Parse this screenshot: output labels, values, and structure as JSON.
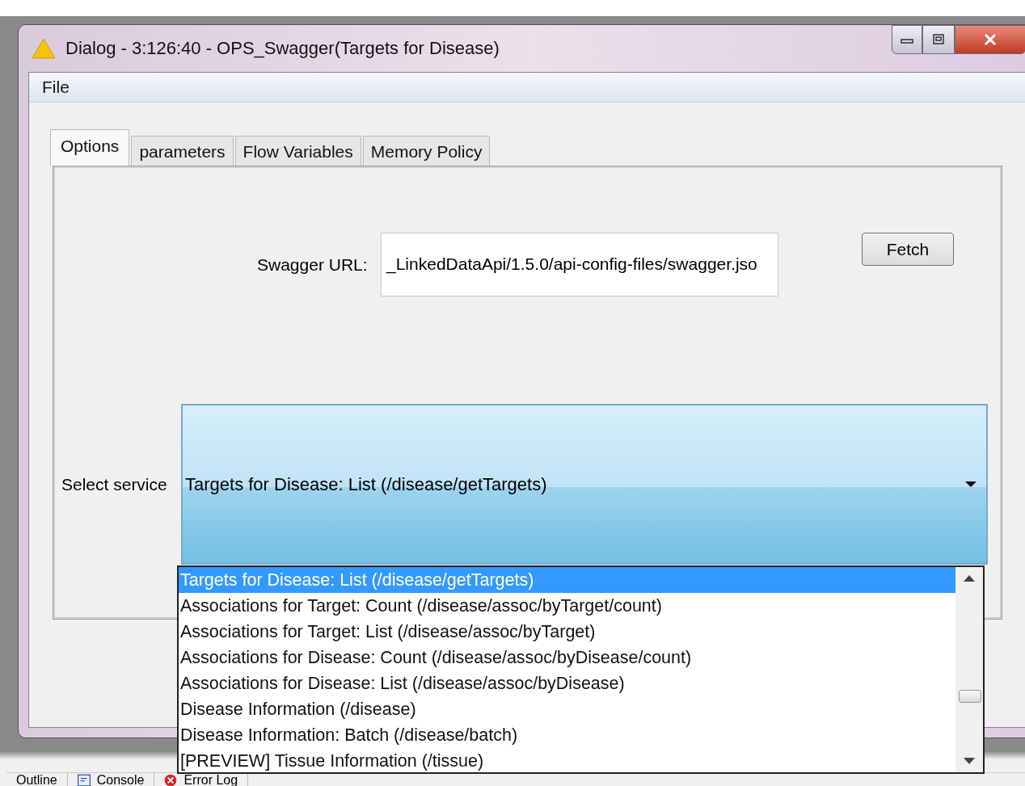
{
  "window": {
    "title": "Dialog - 3:126:40 - OPS_Swagger(Targets for Disease)"
  },
  "menu": [
    "File"
  ],
  "tabs": [
    {
      "label": "Options",
      "selected": true
    },
    {
      "label": "parameters",
      "selected": false
    },
    {
      "label": "Flow Variables",
      "selected": false
    },
    {
      "label": "Memory Policy",
      "selected": false
    }
  ],
  "swagger_url": {
    "label": "Swagger URL:",
    "value": "_LinkedDataApi/1.5.0/api-config-files/swagger.jso"
  },
  "fetch_button": "Fetch",
  "service": {
    "label": "Select service",
    "value": "Targets for Disease: List  (/disease/getTargets)",
    "expanded": true
  },
  "service_options": [
    {
      "label": "Targets for Disease: List  (/disease/getTargets)",
      "selected": true
    },
    {
      "label": "Associations for Target: Count  (/disease/assoc/byTarget/count)",
      "selected": false
    },
    {
      "label": "Associations for Target: List  (/disease/assoc/byTarget)",
      "selected": false
    },
    {
      "label": "Associations for Disease: Count  (/disease/assoc/byDisease/count)",
      "selected": false
    },
    {
      "label": "Associations for Disease: List  (/disease/assoc/byDisease)",
      "selected": false
    },
    {
      "label": "Disease Information  (/disease)",
      "selected": false
    },
    {
      "label": "Disease Information: Batch  (/disease/batch)",
      "selected": false
    },
    {
      "label": "[PREVIEW] Tissue Information  (/tissue)",
      "selected": false
    }
  ],
  "bottom_tabs": [
    {
      "label": "Outline",
      "kind": "outline"
    },
    {
      "label": "Console",
      "kind": "console"
    },
    {
      "label": "Error Log",
      "kind": "error"
    }
  ]
}
